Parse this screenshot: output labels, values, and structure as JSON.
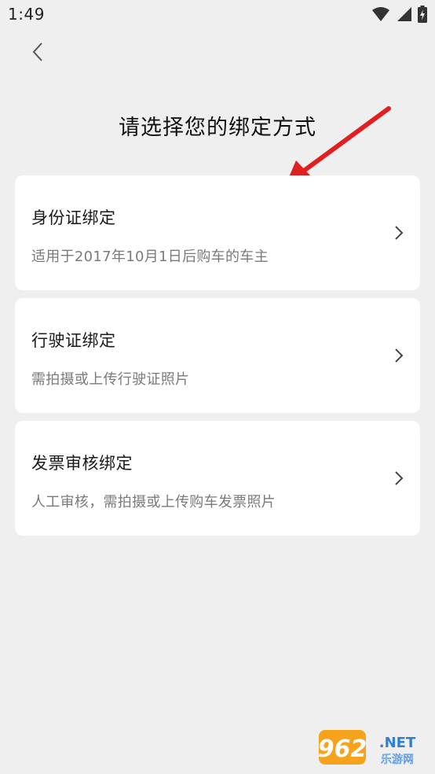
{
  "status_bar": {
    "time": "1:49",
    "icons": [
      "wifi-icon",
      "signal-icon",
      "battery-charging-icon"
    ]
  },
  "header": {
    "back_icon": "chevron-left-icon",
    "title": "请选择您的绑定方式"
  },
  "options": [
    {
      "title": "身份证绑定",
      "description": "适用于2017年10月1日后购车的车主",
      "icon": "chevron-right-icon"
    },
    {
      "title": "行驶证绑定",
      "description": "需拍摄或上传行驶证照片",
      "icon": "chevron-right-icon"
    },
    {
      "title": "发票审核绑定",
      "description": "人工审核，需拍摄或上传购车发票照片",
      "icon": "chevron-right-icon"
    }
  ],
  "annotation": {
    "color": "#e02020"
  },
  "watermark": {
    "number": "962",
    "suffix": ".NET",
    "sub": "乐游网"
  }
}
